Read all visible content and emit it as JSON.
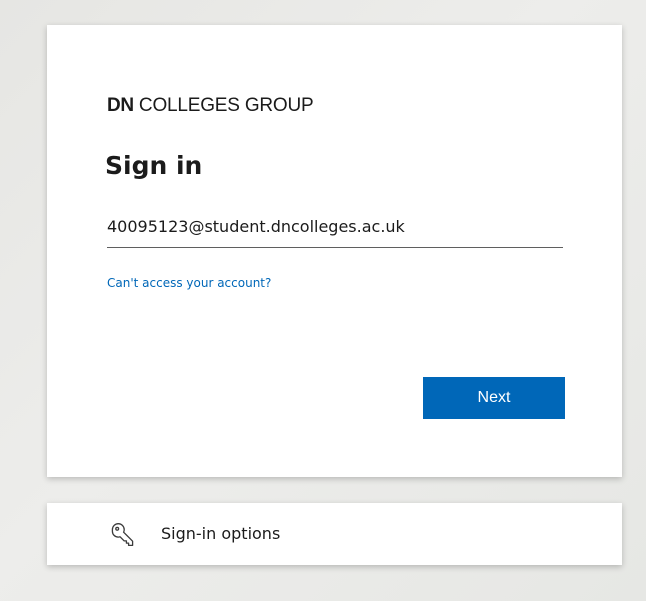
{
  "signin": {
    "logo_bold": "DN",
    "logo_text": " COLLEGES GROUP",
    "title": "Sign in",
    "email_value": "40095123@student.dncolleges.ac.uk",
    "help_link": "Can't access your account?",
    "next_label": "Next"
  },
  "options": {
    "icon": "key-icon",
    "label": "Sign-in options"
  },
  "colors": {
    "accent": "#0067b8",
    "text": "#1b1b1b",
    "background": "#ebebe8",
    "card": "#ffffff"
  }
}
